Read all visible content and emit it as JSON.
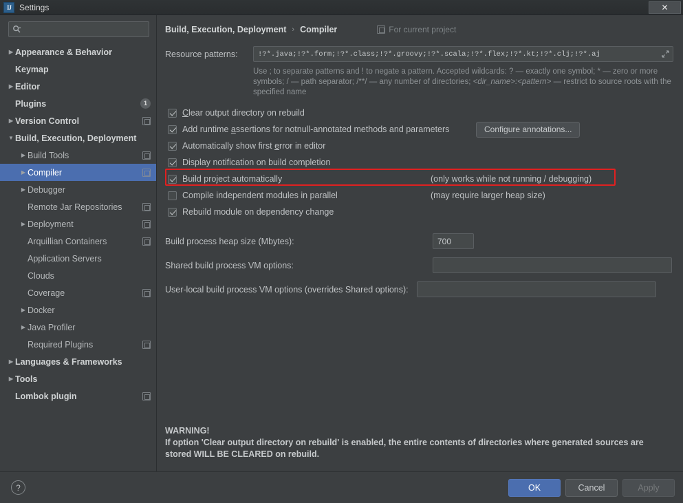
{
  "window": {
    "title": "Settings",
    "app_icon": "IJ",
    "close_label": "✕"
  },
  "sidebar": {
    "search": {
      "value": "",
      "placeholder": "",
      "icon": "search-icon"
    },
    "items": [
      {
        "label": "Appearance & Behavior",
        "arrow": "right",
        "bold": true,
        "indent": 0,
        "scope": false,
        "badge": null,
        "selected": false
      },
      {
        "label": "Keymap",
        "arrow": "none",
        "bold": true,
        "indent": 0,
        "scope": false,
        "badge": null,
        "selected": false
      },
      {
        "label": "Editor",
        "arrow": "right",
        "bold": true,
        "indent": 0,
        "scope": false,
        "badge": null,
        "selected": false
      },
      {
        "label": "Plugins",
        "arrow": "none",
        "bold": true,
        "indent": 0,
        "scope": false,
        "badge": "1",
        "selected": false
      },
      {
        "label": "Version Control",
        "arrow": "right",
        "bold": true,
        "indent": 0,
        "scope": true,
        "badge": null,
        "selected": false
      },
      {
        "label": "Build, Execution, Deployment",
        "arrow": "down",
        "bold": true,
        "indent": 0,
        "scope": false,
        "badge": null,
        "selected": false
      },
      {
        "label": "Build Tools",
        "arrow": "right",
        "bold": false,
        "indent": 1,
        "scope": true,
        "badge": null,
        "selected": false
      },
      {
        "label": "Compiler",
        "arrow": "right",
        "bold": false,
        "indent": 1,
        "scope": true,
        "badge": null,
        "selected": true
      },
      {
        "label": "Debugger",
        "arrow": "right",
        "bold": false,
        "indent": 1,
        "scope": false,
        "badge": null,
        "selected": false
      },
      {
        "label": "Remote Jar Repositories",
        "arrow": "none",
        "bold": false,
        "indent": 1,
        "scope": true,
        "badge": null,
        "selected": false
      },
      {
        "label": "Deployment",
        "arrow": "right",
        "bold": false,
        "indent": 1,
        "scope": true,
        "badge": null,
        "selected": false
      },
      {
        "label": "Arquillian Containers",
        "arrow": "none",
        "bold": false,
        "indent": 1,
        "scope": true,
        "badge": null,
        "selected": false
      },
      {
        "label": "Application Servers",
        "arrow": "none",
        "bold": false,
        "indent": 1,
        "scope": false,
        "badge": null,
        "selected": false
      },
      {
        "label": "Clouds",
        "arrow": "none",
        "bold": false,
        "indent": 1,
        "scope": false,
        "badge": null,
        "selected": false
      },
      {
        "label": "Coverage",
        "arrow": "none",
        "bold": false,
        "indent": 1,
        "scope": true,
        "badge": null,
        "selected": false
      },
      {
        "label": "Docker",
        "arrow": "right",
        "bold": false,
        "indent": 1,
        "scope": false,
        "badge": null,
        "selected": false
      },
      {
        "label": "Java Profiler",
        "arrow": "right",
        "bold": false,
        "indent": 1,
        "scope": false,
        "badge": null,
        "selected": false
      },
      {
        "label": "Required Plugins",
        "arrow": "none",
        "bold": false,
        "indent": 1,
        "scope": true,
        "badge": null,
        "selected": false
      },
      {
        "label": "Languages & Frameworks",
        "arrow": "right",
        "bold": true,
        "indent": 0,
        "scope": false,
        "badge": null,
        "selected": false
      },
      {
        "label": "Tools",
        "arrow": "right",
        "bold": true,
        "indent": 0,
        "scope": false,
        "badge": null,
        "selected": false
      },
      {
        "label": "Lombok plugin",
        "arrow": "none",
        "bold": true,
        "indent": 0,
        "scope": true,
        "badge": null,
        "selected": false
      }
    ]
  },
  "content": {
    "breadcrumb": {
      "parent": "Build, Execution, Deployment",
      "separator": "›",
      "current": "Compiler"
    },
    "scope_note": "For current project",
    "resource_patterns": {
      "label": "Resource patterns:",
      "value": "!?*.java;!?*.form;!?*.class;!?*.groovy;!?*.scala;!?*.flex;!?*.kt;!?*.clj;!?*.aj",
      "expand_icon": "⤡"
    },
    "hint_line1": "Use ; to separate patterns and ! to negate a pattern. Accepted wildcards: ? — exactly one symbol; * — zero or more",
    "hint_line2_a": "symbols; / — path separator; /**/ — any number of directories;  ",
    "hint_line2_i": "<dir_name>:<pattern>",
    "hint_line2_b": " — restrict to source roots",
    "hint_line3": "with the specified name",
    "checkboxes": [
      {
        "label": "Clear output directory on rebuild",
        "mnemonic": "C",
        "checked": true,
        "note": "",
        "highlighted": false
      },
      {
        "label": "Add runtime assertions for notnull-annotated methods and parameters",
        "mnemonic": "a",
        "checked": true,
        "note": "",
        "highlighted": false
      },
      {
        "label": "Automatically show first error in editor",
        "mnemonic": "e",
        "checked": true,
        "note": "",
        "highlighted": false
      },
      {
        "label": "Display notification on build completion",
        "mnemonic": "",
        "checked": true,
        "note": "",
        "highlighted": false
      },
      {
        "label": "Build project automatically",
        "mnemonic": "",
        "checked": true,
        "note": "(only works while not running / debugging)",
        "highlighted": true
      },
      {
        "label": "Compile independent modules in parallel",
        "mnemonic": "",
        "checked": false,
        "note": "(may require larger heap size)",
        "highlighted": false
      },
      {
        "label": "Rebuild module on dependency change",
        "mnemonic": "",
        "checked": true,
        "note": "",
        "highlighted": false
      }
    ],
    "configure_annotations_label": "Configure annotations...",
    "fields": [
      {
        "label": "Build process heap size (Mbytes):",
        "value": "700",
        "placeholder": "",
        "size": "small"
      },
      {
        "label": "Shared build process VM options:",
        "value": "",
        "placeholder": "",
        "size": "wide"
      },
      {
        "label": "User-local build process VM options (overrides Shared options):",
        "value": "",
        "placeholder": "",
        "size": "wide"
      }
    ],
    "warning": {
      "title": "WARNING!",
      "line1": "If option 'Clear output directory on rebuild' is enabled, the entire contents of directories where generated sources are",
      "line2": "stored WILL BE CLEARED on rebuild."
    }
  },
  "footer": {
    "help_label": "?",
    "ok_label": "OK",
    "cancel_label": "Cancel",
    "apply_label": "Apply"
  },
  "colors": {
    "background": "#3c3f41",
    "selection": "#4b6eaf",
    "highlight_annotation": "#e02020",
    "field_background": "#45494a",
    "text": "#bfc2c4"
  }
}
